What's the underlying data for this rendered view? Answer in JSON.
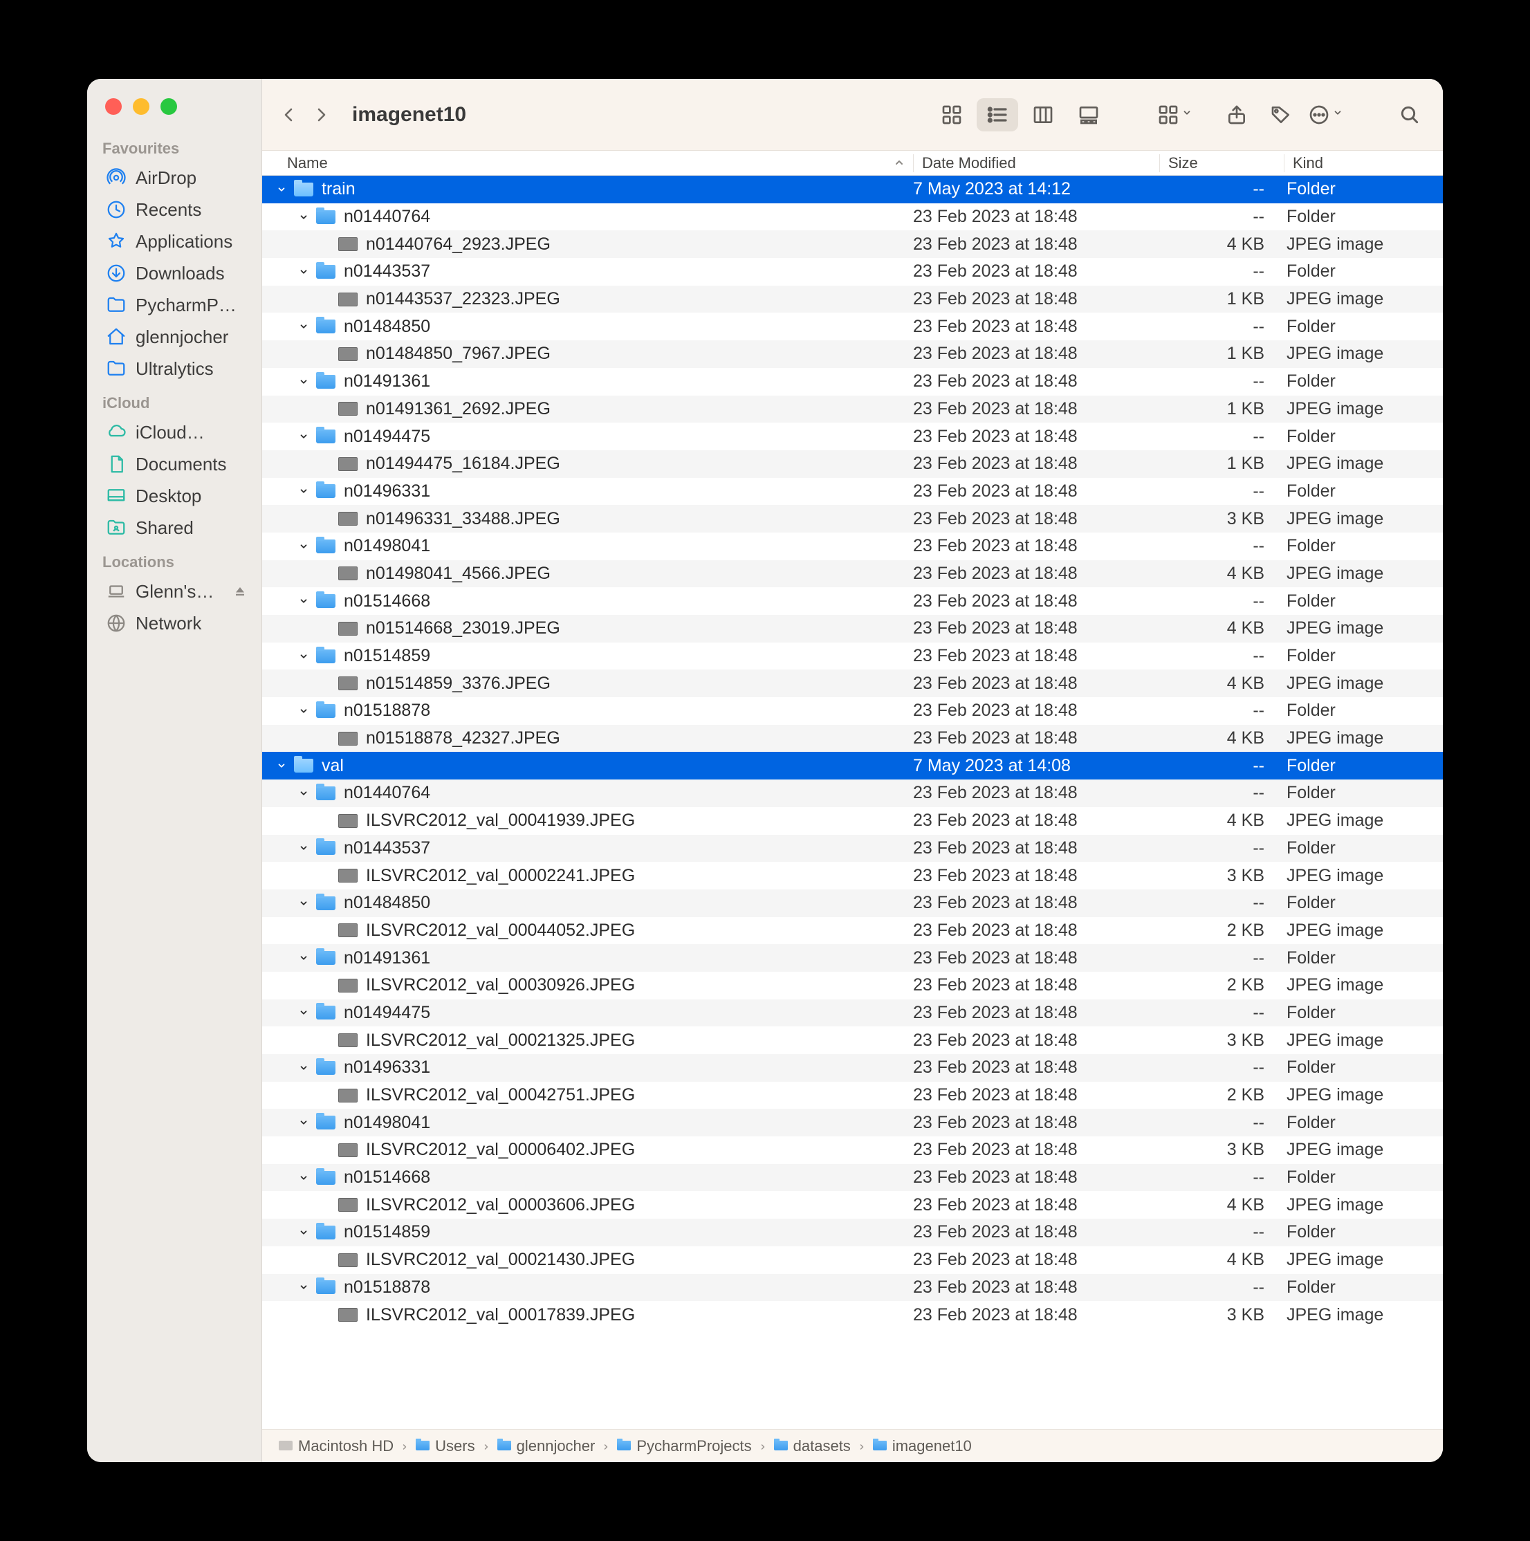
{
  "window": {
    "title": "imagenet10"
  },
  "sidebar": {
    "favourites": {
      "header": "Favourites",
      "items": [
        {
          "label": "AirDrop",
          "icon": "airdrop"
        },
        {
          "label": "Recents",
          "icon": "clock"
        },
        {
          "label": "Applications",
          "icon": "apps"
        },
        {
          "label": "Downloads",
          "icon": "download"
        },
        {
          "label": "PycharmP…",
          "icon": "folder"
        },
        {
          "label": "glennjocher",
          "icon": "home"
        },
        {
          "label": "Ultralytics",
          "icon": "folder"
        }
      ]
    },
    "icloud": {
      "header": "iCloud",
      "items": [
        {
          "label": "iCloud…",
          "icon": "cloud"
        },
        {
          "label": "Documents",
          "icon": "doc"
        },
        {
          "label": "Desktop",
          "icon": "desktop"
        },
        {
          "label": "Shared",
          "icon": "sharedfolder"
        }
      ]
    },
    "locations": {
      "header": "Locations",
      "items": [
        {
          "label": "Glenn's…",
          "icon": "laptop",
          "eject": true
        },
        {
          "label": "Network",
          "icon": "globe"
        }
      ]
    }
  },
  "columns": {
    "name": "Name",
    "date": "Date Modified",
    "size": "Size",
    "kind": "Kind"
  },
  "rows": [
    {
      "depth": 0,
      "name": "train",
      "date": "7 May 2023 at 14:12",
      "size": "--",
      "kind": "Folder",
      "type": "folder",
      "expanded": true,
      "selected": true
    },
    {
      "depth": 1,
      "name": "n01440764",
      "date": "23 Feb 2023 at 18:48",
      "size": "--",
      "kind": "Folder",
      "type": "folder",
      "expanded": true
    },
    {
      "depth": 2,
      "name": "n01440764_2923.JPEG",
      "date": "23 Feb 2023 at 18:48",
      "size": "4 KB",
      "kind": "JPEG image",
      "type": "jpeg"
    },
    {
      "depth": 1,
      "name": "n01443537",
      "date": "23 Feb 2023 at 18:48",
      "size": "--",
      "kind": "Folder",
      "type": "folder",
      "expanded": true
    },
    {
      "depth": 2,
      "name": "n01443537_22323.JPEG",
      "date": "23 Feb 2023 at 18:48",
      "size": "1 KB",
      "kind": "JPEG image",
      "type": "jpeg"
    },
    {
      "depth": 1,
      "name": "n01484850",
      "date": "23 Feb 2023 at 18:48",
      "size": "--",
      "kind": "Folder",
      "type": "folder",
      "expanded": true
    },
    {
      "depth": 2,
      "name": "n01484850_7967.JPEG",
      "date": "23 Feb 2023 at 18:48",
      "size": "1 KB",
      "kind": "JPEG image",
      "type": "jpeg"
    },
    {
      "depth": 1,
      "name": "n01491361",
      "date": "23 Feb 2023 at 18:48",
      "size": "--",
      "kind": "Folder",
      "type": "folder",
      "expanded": true
    },
    {
      "depth": 2,
      "name": "n01491361_2692.JPEG",
      "date": "23 Feb 2023 at 18:48",
      "size": "1 KB",
      "kind": "JPEG image",
      "type": "jpeg"
    },
    {
      "depth": 1,
      "name": "n01494475",
      "date": "23 Feb 2023 at 18:48",
      "size": "--",
      "kind": "Folder",
      "type": "folder",
      "expanded": true
    },
    {
      "depth": 2,
      "name": "n01494475_16184.JPEG",
      "date": "23 Feb 2023 at 18:48",
      "size": "1 KB",
      "kind": "JPEG image",
      "type": "jpeg"
    },
    {
      "depth": 1,
      "name": "n01496331",
      "date": "23 Feb 2023 at 18:48",
      "size": "--",
      "kind": "Folder",
      "type": "folder",
      "expanded": true
    },
    {
      "depth": 2,
      "name": "n01496331_33488.JPEG",
      "date": "23 Feb 2023 at 18:48",
      "size": "3 KB",
      "kind": "JPEG image",
      "type": "jpeg"
    },
    {
      "depth": 1,
      "name": "n01498041",
      "date": "23 Feb 2023 at 18:48",
      "size": "--",
      "kind": "Folder",
      "type": "folder",
      "expanded": true
    },
    {
      "depth": 2,
      "name": "n01498041_4566.JPEG",
      "date": "23 Feb 2023 at 18:48",
      "size": "4 KB",
      "kind": "JPEG image",
      "type": "jpeg"
    },
    {
      "depth": 1,
      "name": "n01514668",
      "date": "23 Feb 2023 at 18:48",
      "size": "--",
      "kind": "Folder",
      "type": "folder",
      "expanded": true
    },
    {
      "depth": 2,
      "name": "n01514668_23019.JPEG",
      "date": "23 Feb 2023 at 18:48",
      "size": "4 KB",
      "kind": "JPEG image",
      "type": "jpeg"
    },
    {
      "depth": 1,
      "name": "n01514859",
      "date": "23 Feb 2023 at 18:48",
      "size": "--",
      "kind": "Folder",
      "type": "folder",
      "expanded": true
    },
    {
      "depth": 2,
      "name": "n01514859_3376.JPEG",
      "date": "23 Feb 2023 at 18:48",
      "size": "4 KB",
      "kind": "JPEG image",
      "type": "jpeg"
    },
    {
      "depth": 1,
      "name": "n01518878",
      "date": "23 Feb 2023 at 18:48",
      "size": "--",
      "kind": "Folder",
      "type": "folder",
      "expanded": true
    },
    {
      "depth": 2,
      "name": "n01518878_42327.JPEG",
      "date": "23 Feb 2023 at 18:48",
      "size": "4 KB",
      "kind": "JPEG image",
      "type": "jpeg"
    },
    {
      "depth": 0,
      "name": "val",
      "date": "7 May 2023 at 14:08",
      "size": "--",
      "kind": "Folder",
      "type": "folder",
      "expanded": true,
      "selected": true
    },
    {
      "depth": 1,
      "name": "n01440764",
      "date": "23 Feb 2023 at 18:48",
      "size": "--",
      "kind": "Folder",
      "type": "folder",
      "expanded": true
    },
    {
      "depth": 2,
      "name": "ILSVRC2012_val_00041939.JPEG",
      "date": "23 Feb 2023 at 18:48",
      "size": "4 KB",
      "kind": "JPEG image",
      "type": "jpeg"
    },
    {
      "depth": 1,
      "name": "n01443537",
      "date": "23 Feb 2023 at 18:48",
      "size": "--",
      "kind": "Folder",
      "type": "folder",
      "expanded": true
    },
    {
      "depth": 2,
      "name": "ILSVRC2012_val_00002241.JPEG",
      "date": "23 Feb 2023 at 18:48",
      "size": "3 KB",
      "kind": "JPEG image",
      "type": "jpeg"
    },
    {
      "depth": 1,
      "name": "n01484850",
      "date": "23 Feb 2023 at 18:48",
      "size": "--",
      "kind": "Folder",
      "type": "folder",
      "expanded": true
    },
    {
      "depth": 2,
      "name": "ILSVRC2012_val_00044052.JPEG",
      "date": "23 Feb 2023 at 18:48",
      "size": "2 KB",
      "kind": "JPEG image",
      "type": "jpeg"
    },
    {
      "depth": 1,
      "name": "n01491361",
      "date": "23 Feb 2023 at 18:48",
      "size": "--",
      "kind": "Folder",
      "type": "folder",
      "expanded": true
    },
    {
      "depth": 2,
      "name": "ILSVRC2012_val_00030926.JPEG",
      "date": "23 Feb 2023 at 18:48",
      "size": "2 KB",
      "kind": "JPEG image",
      "type": "jpeg"
    },
    {
      "depth": 1,
      "name": "n01494475",
      "date": "23 Feb 2023 at 18:48",
      "size": "--",
      "kind": "Folder",
      "type": "folder",
      "expanded": true
    },
    {
      "depth": 2,
      "name": "ILSVRC2012_val_00021325.JPEG",
      "date": "23 Feb 2023 at 18:48",
      "size": "3 KB",
      "kind": "JPEG image",
      "type": "jpeg"
    },
    {
      "depth": 1,
      "name": "n01496331",
      "date": "23 Feb 2023 at 18:48",
      "size": "--",
      "kind": "Folder",
      "type": "folder",
      "expanded": true
    },
    {
      "depth": 2,
      "name": "ILSVRC2012_val_00042751.JPEG",
      "date": "23 Feb 2023 at 18:48",
      "size": "2 KB",
      "kind": "JPEG image",
      "type": "jpeg"
    },
    {
      "depth": 1,
      "name": "n01498041",
      "date": "23 Feb 2023 at 18:48",
      "size": "--",
      "kind": "Folder",
      "type": "folder",
      "expanded": true
    },
    {
      "depth": 2,
      "name": "ILSVRC2012_val_00006402.JPEG",
      "date": "23 Feb 2023 at 18:48",
      "size": "3 KB",
      "kind": "JPEG image",
      "type": "jpeg"
    },
    {
      "depth": 1,
      "name": "n01514668",
      "date": "23 Feb 2023 at 18:48",
      "size": "--",
      "kind": "Folder",
      "type": "folder",
      "expanded": true
    },
    {
      "depth": 2,
      "name": "ILSVRC2012_val_00003606.JPEG",
      "date": "23 Feb 2023 at 18:48",
      "size": "4 KB",
      "kind": "JPEG image",
      "type": "jpeg"
    },
    {
      "depth": 1,
      "name": "n01514859",
      "date": "23 Feb 2023 at 18:48",
      "size": "--",
      "kind": "Folder",
      "type": "folder",
      "expanded": true
    },
    {
      "depth": 2,
      "name": "ILSVRC2012_val_00021430.JPEG",
      "date": "23 Feb 2023 at 18:48",
      "size": "4 KB",
      "kind": "JPEG image",
      "type": "jpeg"
    },
    {
      "depth": 1,
      "name": "n01518878",
      "date": "23 Feb 2023 at 18:48",
      "size": "--",
      "kind": "Folder",
      "type": "folder",
      "expanded": true
    },
    {
      "depth": 2,
      "name": "ILSVRC2012_val_00017839.JPEG",
      "date": "23 Feb 2023 at 18:48",
      "size": "3 KB",
      "kind": "JPEG image",
      "type": "jpeg"
    }
  ],
  "pathbar": [
    {
      "label": "Macintosh HD",
      "icon": "disk"
    },
    {
      "label": "Users",
      "icon": "folder"
    },
    {
      "label": "glennjocher",
      "icon": "folder"
    },
    {
      "label": "PycharmProjects",
      "icon": "folder"
    },
    {
      "label": "datasets",
      "icon": "folder"
    },
    {
      "label": "imagenet10",
      "icon": "folder"
    }
  ]
}
